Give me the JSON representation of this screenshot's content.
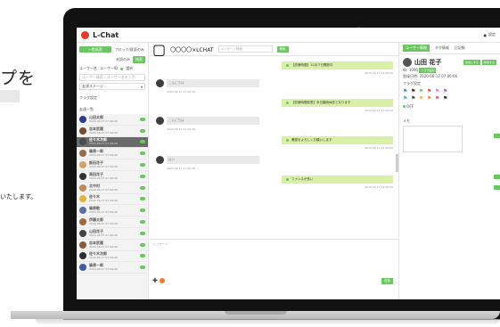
{
  "landing": {
    "headline": "プを",
    "subtext": "いたします。"
  },
  "app": {
    "title": "L-Chat",
    "user_area": "設定"
  },
  "sidebar": {
    "tabs": [
      {
        "label": "一覧画面",
        "active": true
      },
      {
        "label": "ブロック/既読のみ",
        "active": false
      }
    ],
    "filter_label": "未読のみ",
    "filter_button": "検索",
    "toggle_left": "ユーザー名",
    "toggle_right": "ユーザーID",
    "toggle_extra": "選択",
    "search_placeholder": "ユーザー検索 / ユーザー名を入力",
    "group_select": "友達ステージ",
    "tag_section": "フラグ設定",
    "friend_section": "友達一覧",
    "users": [
      {
        "name": "山田太郎",
        "date": "2020-06-17 07:06:06",
        "avatar": "#2b3c8f",
        "selected": false
      },
      {
        "name": "吉本武蔵",
        "date": "2020-06-17 07:06:06",
        "avatar": "#7a4a2c",
        "selected": false
      },
      {
        "name": "佐々木次郎",
        "date": "2020-06-17 07:06:06",
        "avatar": "#4a4a4a",
        "selected": true
      },
      {
        "name": "篠原一郎",
        "date": "2020-06-17 07:06:06",
        "avatar": "#9b6b45",
        "selected": false
      },
      {
        "name": "飯田花子",
        "date": "2020-06-17 07:06:06",
        "avatar": "#d2a46b",
        "selected": false
      },
      {
        "name": "高田花子",
        "date": "2020-06-17 07:06:06",
        "avatar": "#333333",
        "selected": false
      },
      {
        "name": "北中村",
        "date": "2020-06-17 07:06:06",
        "avatar": "#c08a5a",
        "selected": false
      },
      {
        "name": "佐々木",
        "date": "2020-06-17 07:06:06",
        "avatar": "#e6b33a",
        "selected": false
      },
      {
        "name": "篠原敬",
        "date": "2020-06-17 07:06:06",
        "avatar": "#5c6fa8",
        "selected": false
      },
      {
        "name": "伊藤太郎",
        "date": "2020-06-17 07:06:06",
        "avatar": "#a06a3a",
        "selected": false
      },
      {
        "name": "山田花子",
        "date": "2020-06-17 07:06:06",
        "avatar": "#444444",
        "selected": false
      },
      {
        "name": "吉本武蔵",
        "date": "2020-06-17 07:06:06",
        "avatar": "#8c5a36",
        "selected": false
      },
      {
        "name": "佐々木次郎",
        "date": "2020-06-17 07:06:06",
        "avatar": "#2f2f2f",
        "selected": false
      },
      {
        "name": "篠原一郎",
        "date": "2020-06-17 07:06:06",
        "avatar": "#3e5aa8",
        "selected": false
      }
    ]
  },
  "chat": {
    "title": "〇〇〇〇×LCHAT",
    "search_placeholder": "メッセージ検索",
    "search_button": "検索",
    "messages": [
      {
        "side": "out",
        "text": "【診療時間】12月３日開放中",
        "date": "2020-06-17 17:06:06"
      },
      {
        "side": "in",
        "text": "こんにちは",
        "date": "2020-06-17 07:06:06"
      },
      {
        "side": "out",
        "text": "【診療時間変更】本日臨時休診となります",
        "date": "2020-06-17 17:06:06"
      },
      {
        "side": "in",
        "text": "こんにちは",
        "date": "2020-06-17 07:06:06"
      },
      {
        "side": "out",
        "text": "確認をよろしくお願いします",
        "date": "2020-06-17 17:06:06"
      },
      {
        "side": "in",
        "text": "はい",
        "date": "2020-06-17 07:06:06"
      },
      {
        "side": "out",
        "text": "ファンスが多い",
        "date": "2020-06-17 17:06:06"
      }
    ],
    "compose_placeholder": "メッセージ",
    "send_button": "送信"
  },
  "profile": {
    "tabs": [
      {
        "label": "ユーザー情報",
        "active": true
      },
      {
        "label": "タグ情報",
        "active": false
      },
      {
        "label": "日記帳",
        "active": false
      }
    ],
    "name": "山田 花子",
    "buttons": [
      "友達にする",
      "削除する"
    ],
    "id_label": "ID: 1090",
    "id_button": "フラグ設定",
    "registered": "登録日時: 2020-06-17 07:06:06",
    "flag_label": "フラグ設定",
    "flag_colors": [
      "#4a7cd8",
      "#222222",
      "#6dc563",
      "#d84a4a",
      "#e07bd0",
      "#9a5ad8",
      "#3ab0d8",
      "#3a3a3a",
      "#e6b33a",
      "#f08a3a",
      "#e04a8a",
      "#222222"
    ],
    "status_text": "OFF",
    "memo_label": "メモ"
  }
}
